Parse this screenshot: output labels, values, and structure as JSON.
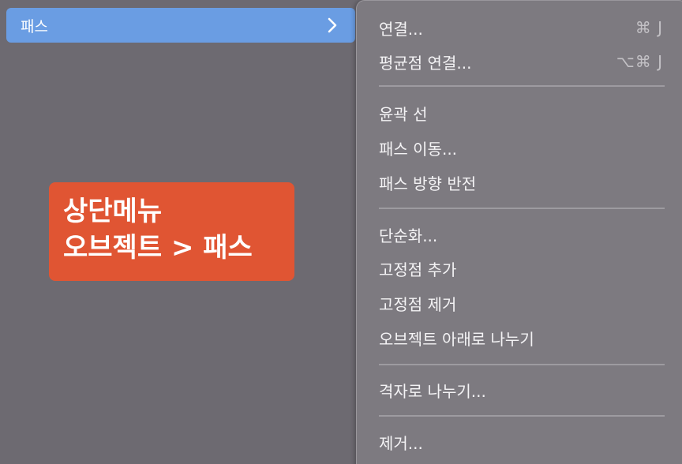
{
  "parent_menu": {
    "highlighted_item": "패스"
  },
  "callout": {
    "line1": "상단메뉴",
    "line2": "오브젝트 > 패스"
  },
  "submenu": {
    "join": {
      "label": "연결...",
      "shortcut": "⌘ J"
    },
    "average": {
      "label": "평균점 연결...",
      "shortcut": "⌥⌘ J"
    },
    "outline_stroke": {
      "label": "윤곽 선"
    },
    "offset_path": {
      "label": "패스 이동..."
    },
    "reverse_direction": {
      "label": "패스 방향 반전"
    },
    "simplify": {
      "label": "단순화..."
    },
    "add_anchor": {
      "label": "고정점 추가"
    },
    "remove_anchor": {
      "label": "고정점 제거"
    },
    "divide_objects_below": {
      "label": "오브젝트 아래로 나누기"
    },
    "split_into_grid": {
      "label": "격자로 나누기..."
    },
    "clean_up": {
      "label": "제거..."
    }
  }
}
